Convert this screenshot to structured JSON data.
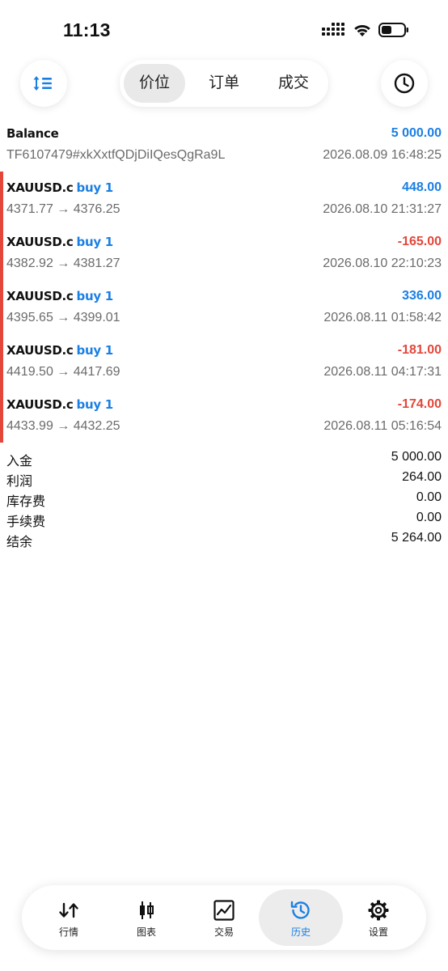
{
  "status_bar": {
    "time": "11:13"
  },
  "toolbar": {
    "tabs": [
      {
        "label": "价位",
        "active": true
      },
      {
        "label": "订单",
        "active": false
      },
      {
        "label": "成交",
        "active": false
      }
    ],
    "left_icon": "sort-arrows-icon",
    "right_icon": "clock-icon"
  },
  "balance": {
    "title": "Balance",
    "amount": "5 000.00",
    "account": "TF6107479#xkXxtfQDjDiIQesQgRa9L",
    "time": "2026.08.09 16:48:25"
  },
  "deals": [
    {
      "symbol": "XAUUSD.c",
      "side": "buy 1",
      "profit": "448.00",
      "sign": "positive",
      "prices": "4371.77 → 4376.25",
      "time": "2026.08.10 21:31:27"
    },
    {
      "symbol": "XAUUSD.c",
      "side": "buy 1",
      "profit": "-165.00",
      "sign": "negative",
      "prices": "4382.92 → 4381.27",
      "time": "2026.08.10 22:10:23"
    },
    {
      "symbol": "XAUUSD.c",
      "side": "buy 1",
      "profit": "336.00",
      "sign": "positive",
      "prices": "4395.65 → 4399.01",
      "time": "2026.08.11 01:58:42"
    },
    {
      "symbol": "XAUUSD.c",
      "side": "buy 1",
      "profit": "-181.00",
      "sign": "negative",
      "prices": "4419.50 → 4417.69",
      "time": "2026.08.11 04:17:31"
    },
    {
      "symbol": "XAUUSD.c",
      "side": "buy 1",
      "profit": "-174.00",
      "sign": "negative",
      "prices": "4433.99 → 4432.25",
      "time": "2026.08.11 05:16:54"
    }
  ],
  "summary": [
    {
      "label": "入金",
      "value": "5 000.00"
    },
    {
      "label": "利润",
      "value": "264.00"
    },
    {
      "label": "库存费",
      "value": "0.00"
    },
    {
      "label": "手续费",
      "value": "0.00"
    },
    {
      "label": "结余",
      "value": "5 264.00"
    }
  ],
  "bottom_nav": [
    {
      "label": "行情",
      "icon": "quotes-arrows-icon",
      "active": false
    },
    {
      "label": "图表",
      "icon": "candlestick-chart-icon",
      "active": false
    },
    {
      "label": "交易",
      "icon": "trade-chart-icon",
      "active": false
    },
    {
      "label": "历史",
      "icon": "history-clock-icon",
      "active": true
    },
    {
      "label": "设置",
      "icon": "gear-icon",
      "active": false
    }
  ],
  "colors": {
    "accent": "#1a7fe3",
    "loss": "#e2473a",
    "muted": "#6b6b6b"
  }
}
